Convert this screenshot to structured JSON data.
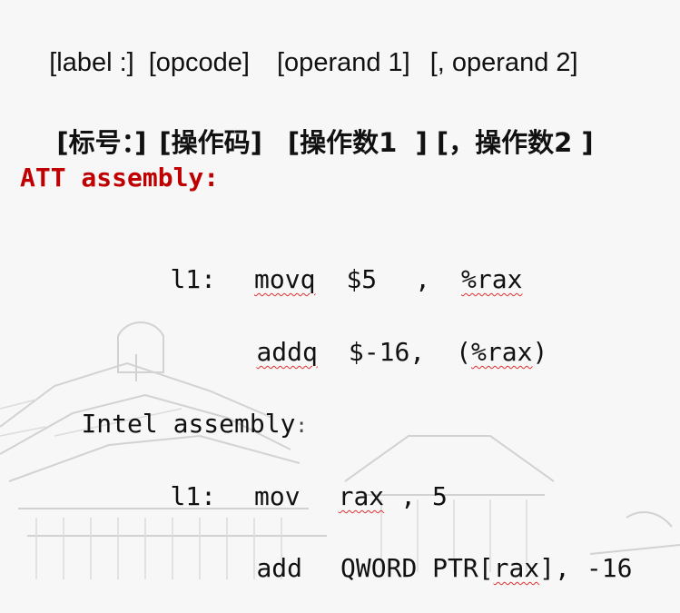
{
  "syntax_en": {
    "label": "[label :]",
    "opcode": "[opcode]",
    "operand1": "[operand 1]",
    "operand2": "[, operand 2]"
  },
  "syntax_zh": {
    "label": "[标号：]",
    "opcode": "[操作码]",
    "operand1": "[操作数1  ]",
    "operand2": "[，操作数2 ]"
  },
  "att": {
    "heading": "ATT assembly:",
    "line1": {
      "label": "l1:",
      "op": "movq",
      "arg1": "$5",
      "sep": ",",
      "arg2": "%rax"
    },
    "line2": {
      "op": "addq",
      "arg1": "$-16,",
      "arg2_open": "(",
      "arg2_reg": "%rax",
      "arg2_close": ")"
    }
  },
  "intel": {
    "heading": "Intel assembly",
    "heading_colon": ":",
    "line1": {
      "label": "l1:",
      "op": "mov",
      "arg1": "rax",
      "sep": ",",
      "arg2": "5"
    },
    "line2": {
      "op": "add",
      "arg1_prefix": "QWORD PTR[",
      "arg1_reg": "rax",
      "arg1_suffix": "],",
      "arg2": "-16"
    }
  },
  "colors": {
    "heading_red": "#c00000",
    "spellcheck_red": "#e03030",
    "text": "#111111",
    "background": "#f7f7f7",
    "watermark": "#d4d4d4"
  }
}
